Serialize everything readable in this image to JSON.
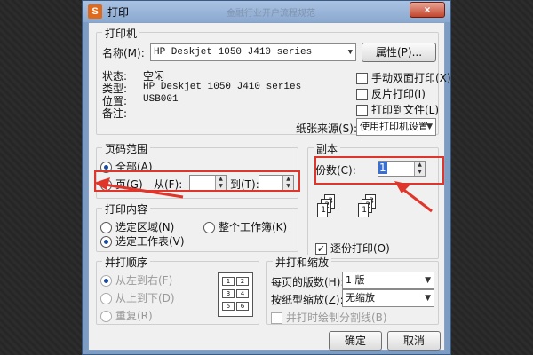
{
  "window": {
    "title": "打印",
    "app_badge": "S",
    "ghost_title": "金融行业开户流程规范",
    "close": "×"
  },
  "printer": {
    "group_title": "打印机",
    "name_label": "名称(M):",
    "name_value": "HP Deskjet 1050 J410 series",
    "properties_button": "属性(P)...",
    "status_label": "状态:",
    "status_value": "空闲",
    "type_label": "类型:",
    "type_value": "HP Deskjet 1050 J410 series",
    "location_label": "位置:",
    "location_value": "USB001",
    "comment_label": "备注:",
    "manual_duplex": "手动双面打印(X)",
    "reverse_print": "反片打印(I)",
    "print_to_file": "打印到文件(L)",
    "paper_source_label": "纸张来源(S):",
    "paper_source_value": "使用打印机设置"
  },
  "page_range": {
    "group_title": "页码范围",
    "all": "全部(A)",
    "pages": "页(G)",
    "from_label": "从(F):",
    "from_value": "",
    "to_label": "到(T):",
    "to_value": ""
  },
  "copies": {
    "group_title": "副本",
    "count_label": "份数(C):",
    "count_value": "1",
    "collate": "逐份打印(O)"
  },
  "content": {
    "group_title": "打印内容",
    "selection": "选定区域(N)",
    "whole_workbook": "整个工作簿(K)",
    "active_sheet": "选定工作表(V)"
  },
  "order": {
    "group_title": "并打顺序",
    "left_to_right": "从左到右(F)",
    "top_to_bottom": "从上到下(D)",
    "repeat": "重复(R)",
    "icon_digits": [
      "1",
      "2",
      "3",
      "4",
      "5",
      "6"
    ]
  },
  "scale": {
    "group_title": "并打和缩放",
    "pages_per_sheet_label": "每页的版数(H):",
    "pages_per_sheet_value": "1 版",
    "scale_to_paper_label": "按纸型缩放(Z):",
    "scale_to_paper_value": "无缩放",
    "draw_borders": "并打时绘制分割线(B)"
  },
  "buttons": {
    "ok": "确定",
    "cancel": "取消"
  },
  "collate_icon_digits": [
    "3",
    "2",
    "1",
    "3",
    "2",
    "1"
  ],
  "colors": {
    "annotation_red": "#e0352b",
    "title_bar": "#8aa8cf"
  }
}
